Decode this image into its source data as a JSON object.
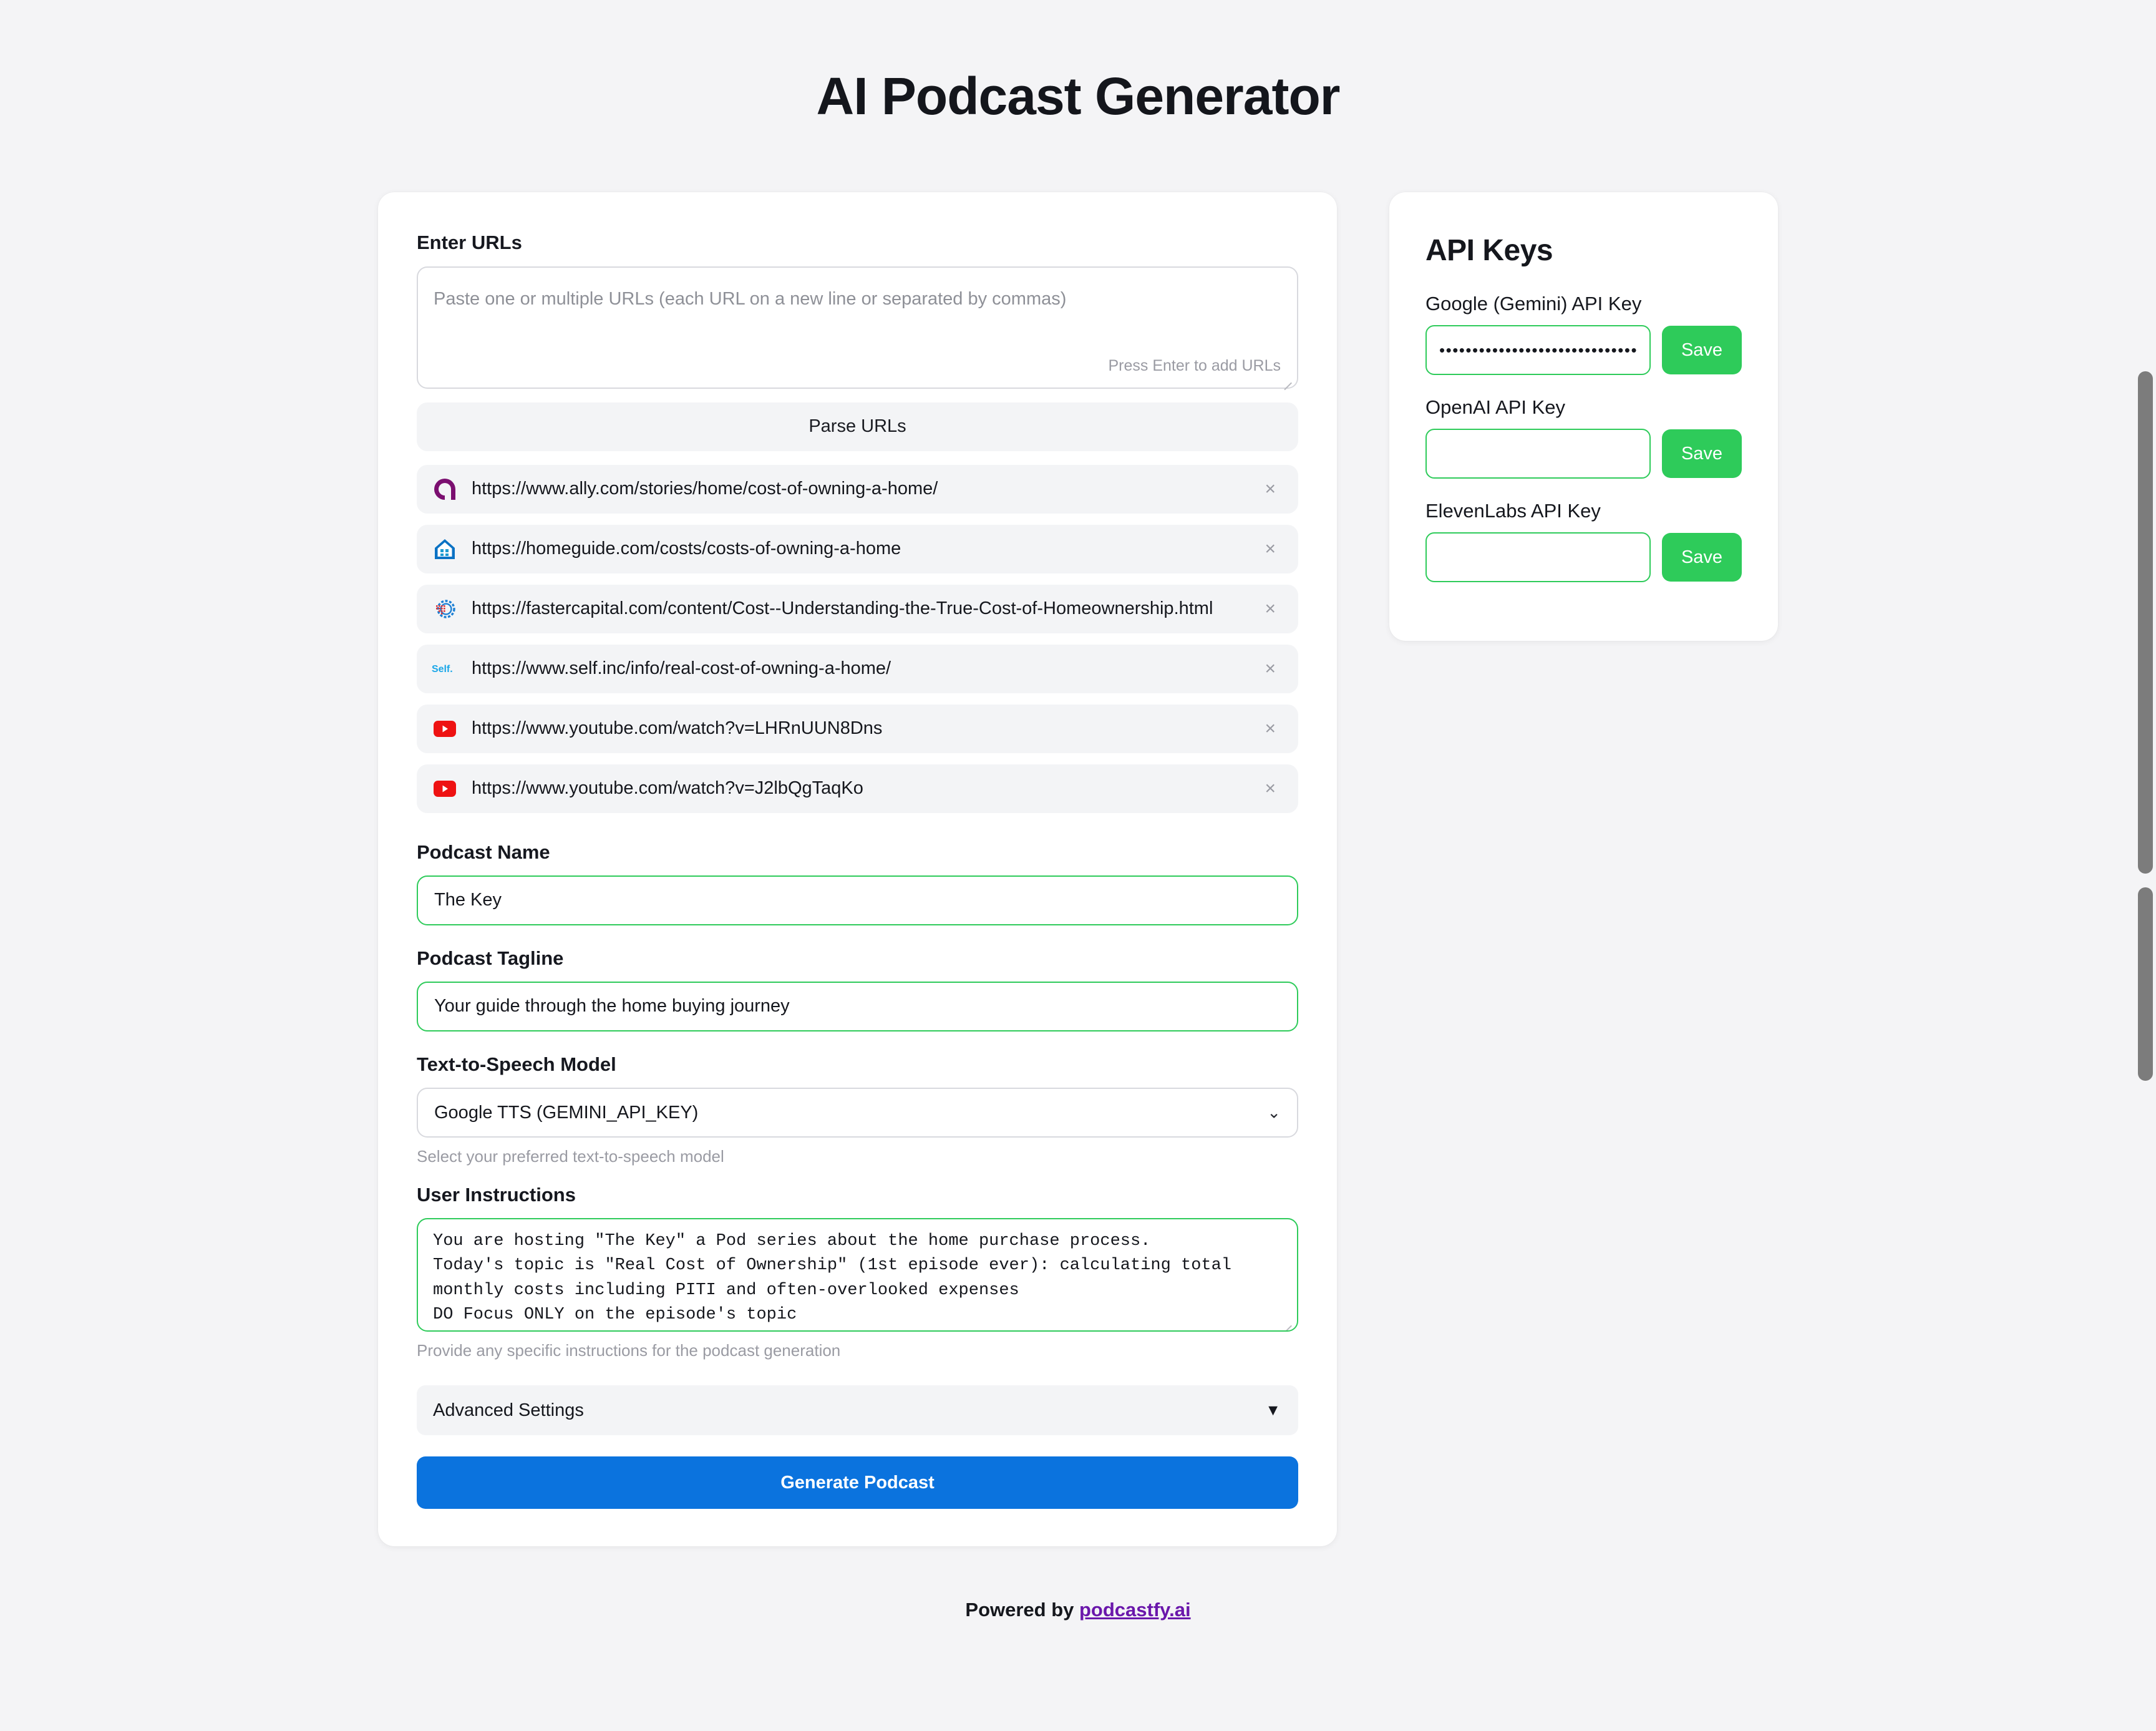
{
  "page": {
    "title": "AI Podcast Generator"
  },
  "form": {
    "urls_label": "Enter URLs",
    "urls_placeholder": "Paste one or multiple URLs (each URL on a new line or separated by commas)",
    "urls_value": "",
    "urls_hint": "Press Enter to add URLs",
    "parse_button": "Parse URLs",
    "url_items": [
      {
        "url": "https://www.ally.com/stories/home/cost-of-owning-a-home/",
        "favicon": "ally-icon",
        "remove": "×"
      },
      {
        "url": "https://homeguide.com/costs/costs-of-owning-a-home",
        "favicon": "homeguide-house-icon",
        "remove": "×"
      },
      {
        "url": "https://fastercapital.com/content/Cost--Understanding-the-True-Cost-of-Homeownership.html",
        "favicon": "fastercapital-gear-icon",
        "remove": "×"
      },
      {
        "url": "https://www.self.inc/info/real-cost-of-owning-a-home/",
        "favicon": "self-icon",
        "remove": "×"
      },
      {
        "url": "https://www.youtube.com/watch?v=LHRnUUN8Dns",
        "favicon": "youtube-icon",
        "remove": "×"
      },
      {
        "url": "https://www.youtube.com/watch?v=J2lbQgTaqKo",
        "favicon": "youtube-icon",
        "remove": "×"
      }
    ],
    "podcast_name_label": "Podcast Name",
    "podcast_name_value": "The Key",
    "podcast_tagline_label": "Podcast Tagline",
    "podcast_tagline_value": "Your guide through the home buying journey",
    "tts_label": "Text-to-Speech Model",
    "tts_value": "Google TTS (GEMINI_API_KEY)",
    "tts_caret": "⌄",
    "tts_help": "Select your preferred text-to-speech model",
    "instructions_label": "User Instructions",
    "instructions_value": "You are hosting \"The Key\" a Pod series about the home purchase process.\nToday's topic is \"Real Cost of Ownership\" (1st episode ever): calculating total\nmonthly costs including PITI and often-overlooked expenses\nDO Focus ONLY on the episode's topic\nDO Keep it short",
    "instructions_help": "Provide any specific instructions for the podcast generation",
    "advanced_label": "Advanced Settings",
    "advanced_caret": "▼",
    "generate_button": "Generate Podcast"
  },
  "api_keys": {
    "title": "API Keys",
    "entries": [
      {
        "label": "Google (Gemini) API Key",
        "value": "••••••••••••••••••••••••••••••••••••••",
        "save_label": "Save"
      },
      {
        "label": "OpenAI API Key",
        "value": "",
        "save_label": "Save"
      },
      {
        "label": "ElevenLabs API Key",
        "value": "",
        "save_label": "Save"
      }
    ]
  },
  "footer": {
    "prefix": "Powered by ",
    "link_text": "podcastfy.ai"
  },
  "colors": {
    "page_background": "#f4f4f6",
    "card_background": "#ffffff",
    "accent_green": "#2ecb5a",
    "accent_blue": "#0b73de",
    "link_purple": "#6a17ab",
    "muted_field": "#f3f4f6"
  }
}
